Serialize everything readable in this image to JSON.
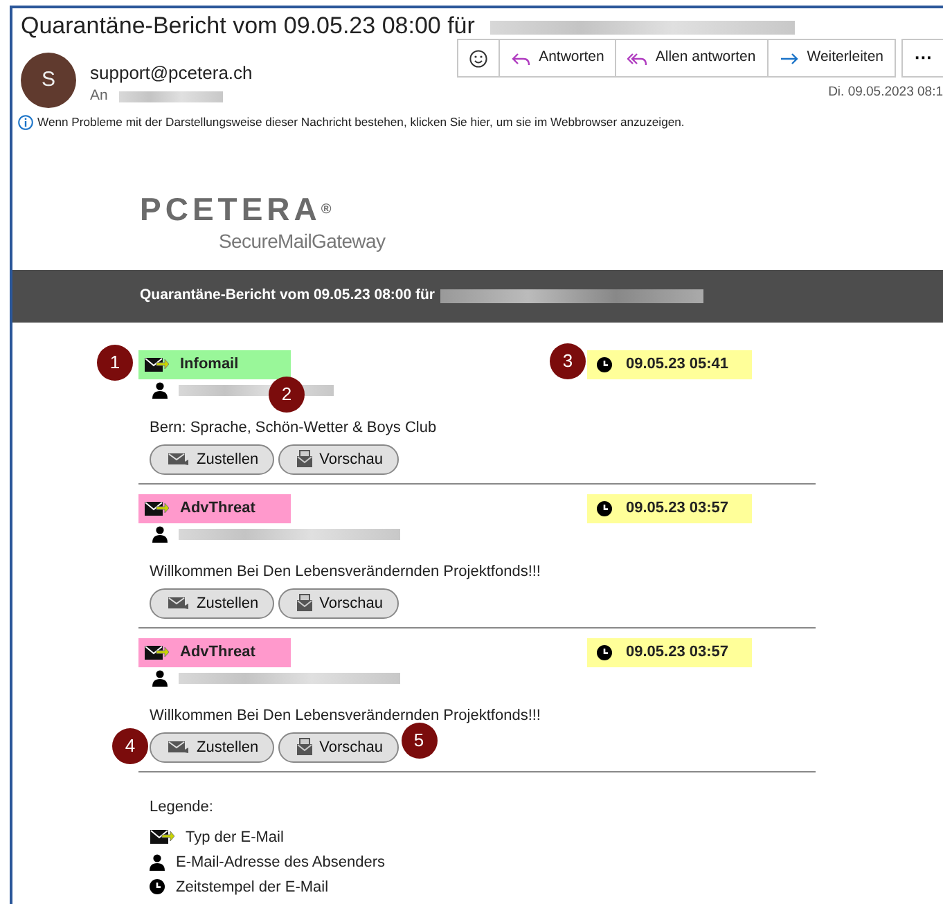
{
  "window": {
    "title": "Quarantäne-Bericht vom 09.05.23 08:00 für"
  },
  "header": {
    "avatar_letter": "S",
    "sender": "support@pcetera.ch",
    "to_label": "An",
    "date": "Di. 09.05.2023 08:1"
  },
  "toolbar": [
    {
      "kind": "emoji"
    },
    {
      "kind": "reply",
      "label": "Antworten"
    },
    {
      "kind": "reply_all",
      "label": "Allen antworten"
    },
    {
      "kind": "forward",
      "label": "Weiterleiten"
    },
    {
      "kind": "more",
      "label": "···"
    }
  ],
  "info_notice": "Wenn Probleme mit der Darstellungsweise dieser Nachricht bestehen, klicken Sie hier, um sie im Webbrowser anzuzeigen.",
  "logo": {
    "brand": "PCETERA",
    "mark": "®",
    "product": "SecureMailGateway"
  },
  "banner": "Quarantäne-Bericht vom 09.05.23 08:00 für",
  "messages": [
    {
      "category": "Infomail",
      "color": "#99f799",
      "category_callout": "1",
      "sender_callout": "2",
      "timestamp": "09.05.23 05:41",
      "timestamp_callout": "3",
      "subject": "Bern: Sprache, Schön-Wetter & Boys Club",
      "actions": [
        {
          "kind": "deliver",
          "label": "Zustellen"
        },
        {
          "kind": "preview",
          "label": "Vorschau"
        }
      ]
    },
    {
      "category": "AdvThreat",
      "color": "#ff99cc",
      "timestamp": "09.05.23 03:57",
      "subject": "Willkommen Bei Den Lebensverändernden Projektfonds!!!",
      "actions": [
        {
          "kind": "deliver",
          "label": "Zustellen"
        },
        {
          "kind": "preview",
          "label": "Vorschau"
        }
      ]
    },
    {
      "category": "AdvThreat",
      "color": "#ff99cc",
      "timestamp": "09.05.23 03:57",
      "subject": "Willkommen Bei Den Lebensverändernden Projektfonds!!!",
      "actions": [
        {
          "kind": "deliver",
          "label": "Zustellen",
          "callout": "4"
        },
        {
          "kind": "preview",
          "label": "Vorschau",
          "callout": "5"
        }
      ]
    }
  ],
  "legend": {
    "title": "Legende:",
    "items": [
      {
        "kind": "type",
        "label": "Typ der E-Mail"
      },
      {
        "kind": "sender",
        "label": "E-Mail-Adresse des Absenders"
      },
      {
        "kind": "time",
        "label": "Zeitstempel der E-Mail"
      }
    ]
  }
}
